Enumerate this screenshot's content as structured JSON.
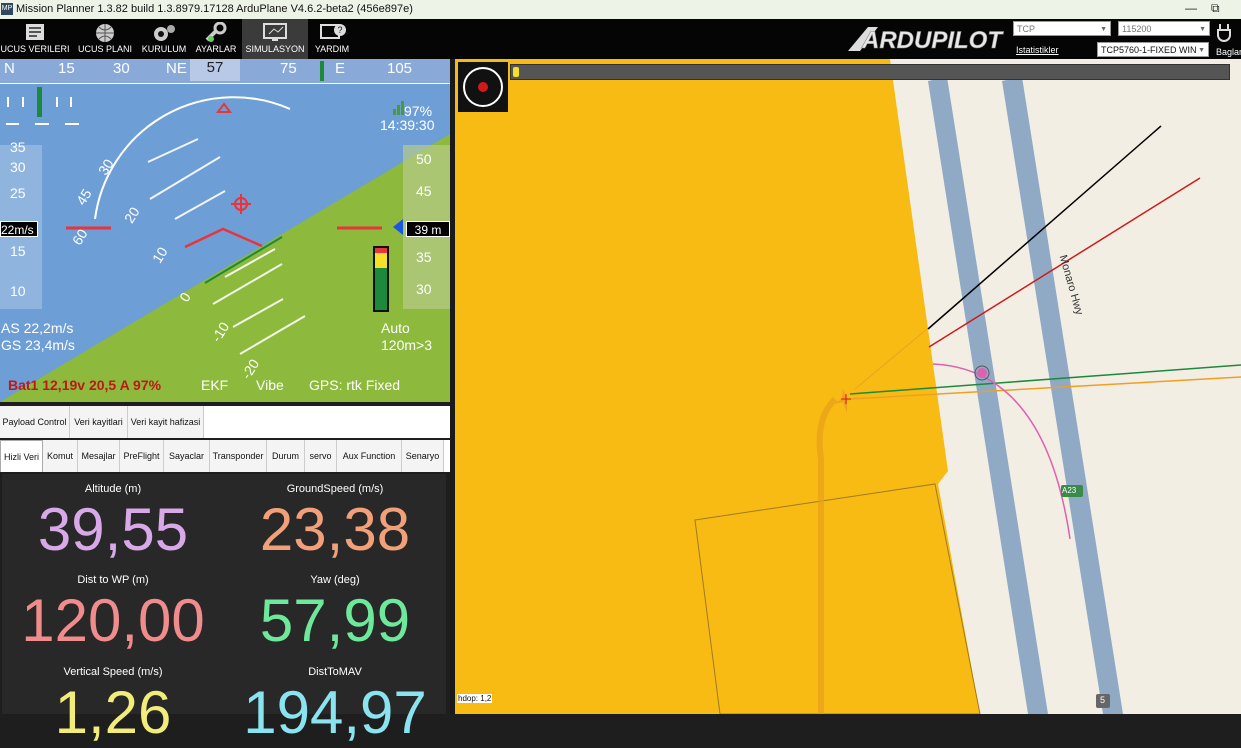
{
  "window": {
    "title": "Mission Planner 1.3.82 build 1.3.8979.17128 ArduPlane V4.6.2-beta2 (456e897e)",
    "minimize_glyph": "—",
    "restore_glyph": "⧉"
  },
  "toolbar": {
    "buttons": [
      {
        "label": "UCUS VERILERI",
        "icon": "flight-data-icon"
      },
      {
        "label": "UCUS PLANI",
        "icon": "globe-icon"
      },
      {
        "label": "KURULUM",
        "icon": "gear-icon"
      },
      {
        "label": "AYARLAR",
        "icon": "wrench-icon"
      },
      {
        "label": "SIMULASYON",
        "icon": "monitor-icon"
      },
      {
        "label": "YARDIM",
        "icon": "help-icon"
      }
    ],
    "logo": "ARDUPILOT",
    "connection_type": "TCP",
    "baud_rate": "115200",
    "stats_link": "Istatistikler",
    "port": "TCP5760-1-FIXED WIN",
    "connect_label": "Baglan"
  },
  "hud": {
    "compass": {
      "n": "N",
      "v15": "15",
      "v30": "30",
      "ne": "NE",
      "heading": "57",
      "v75": "75",
      "e": "E",
      "v105": "105"
    },
    "pitch_labels": [
      "10",
      "20",
      "30",
      "45",
      "60",
      "0",
      "-10",
      "-20"
    ],
    "speed_ticks": [
      "35",
      "30",
      "25",
      "20",
      "15",
      "10"
    ],
    "alt_ticks": [
      "50",
      "45",
      "35",
      "30"
    ],
    "speed_box": "22m/s",
    "alt_box": "39 m",
    "rssi": "97%",
    "time": "14:39:30",
    "airspeed": "AS 22,2m/s",
    "groundspeed": "GS 23,4m/s",
    "mode": "Auto",
    "wp_info": "120m>3",
    "battery": "Bat1 12,19v 20,5 A 97%",
    "ekf": "EKF",
    "vibe": "Vibe",
    "gps": "GPS: rtk Fixed"
  },
  "tabs_row1": [
    "Payload Control",
    "Veri kayitlari",
    "Veri kayit hafizasi"
  ],
  "tabs_row2": [
    "Hizli Veri",
    "Komut",
    "Mesajlar",
    "PreFlight",
    "Sayaclar",
    "Transponder",
    "Durum",
    "servo",
    "Aux Function",
    "Senaryo"
  ],
  "quick": [
    {
      "label": "Altitude (m)",
      "value": "39,55",
      "color": "#d9a8e8"
    },
    {
      "label": "GroundSpeed (m/s)",
      "value": "23,38",
      "color": "#f2a07a"
    },
    {
      "label": "Dist to WP (m)",
      "value": "120,00",
      "color": "#f08c8c"
    },
    {
      "label": "Yaw (deg)",
      "value": "57,99",
      "color": "#6ee89a"
    },
    {
      "label": "Vertical Speed (m/s)",
      "value": "1,26",
      "color": "#f2ec7a"
    },
    {
      "label": "DistToMAV",
      "value": "194,97",
      "color": "#8ae4f0"
    }
  ],
  "map": {
    "road_name": "Monaro Hwy",
    "road_badge": "A23",
    "marker_badge": "5",
    "hdop": "hdop: 1,2"
  }
}
